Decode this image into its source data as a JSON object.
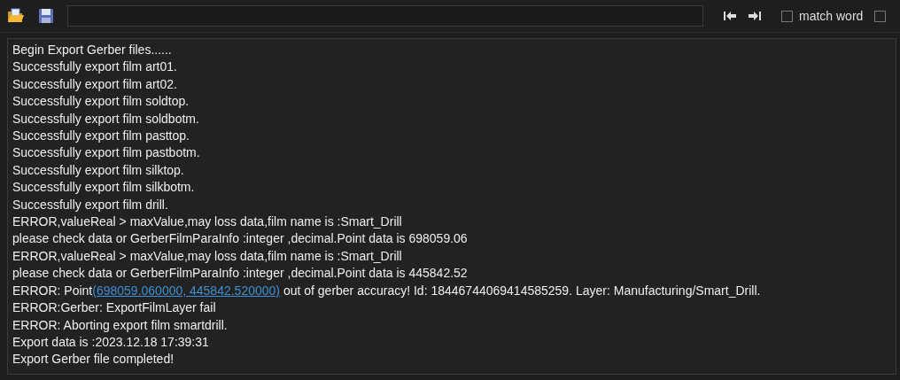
{
  "toolbar": {
    "match_word": {
      "label": "match word",
      "checked": false
    },
    "extra_checkbox": {
      "checked": false
    }
  },
  "log": [
    {
      "kind": "text",
      "text": "Begin Export Gerber files......"
    },
    {
      "kind": "text",
      "text": "Successfully export film art01."
    },
    {
      "kind": "text",
      "text": "Successfully export film art02."
    },
    {
      "kind": "text",
      "text": "Successfully export film soldtop."
    },
    {
      "kind": "text",
      "text": "Successfully export film soldbotm."
    },
    {
      "kind": "text",
      "text": "Successfully export film pasttop."
    },
    {
      "kind": "text",
      "text": "Successfully export film pastbotm."
    },
    {
      "kind": "text",
      "text": "Successfully export film silktop."
    },
    {
      "kind": "text",
      "text": "Successfully export film silkbotm."
    },
    {
      "kind": "text",
      "text": "Successfully export film drill."
    },
    {
      "kind": "text",
      "text": "ERROR,valueReal > maxValue,may loss data,film name is :Smart_Drill"
    },
    {
      "kind": "text",
      "text": "please check data or GerberFilmParaInfo :integer ,decimal.Point data is 698059.06"
    },
    {
      "kind": "text",
      "text": "ERROR,valueReal > maxValue,may loss data,film name is :Smart_Drill"
    },
    {
      "kind": "text",
      "text": "please check data or GerberFilmParaInfo :integer ,decimal.Point data is 445842.52"
    },
    {
      "kind": "link",
      "before": "ERROR: Point",
      "link": "(698059.060000, 445842.520000)",
      "after": " out of gerber accuracy! Id: 18446744069414585259. Layer: Manufacturing/Smart_Drill."
    },
    {
      "kind": "text",
      "text": "ERROR:Gerber: ExportFilmLayer fail"
    },
    {
      "kind": "text",
      "text": "ERROR: Aborting export film smartdrill."
    },
    {
      "kind": "text",
      "text": "Export data is :2023.12.18 17:39:31"
    },
    {
      "kind": "text",
      "text": "Export Gerber file completed!"
    }
  ]
}
